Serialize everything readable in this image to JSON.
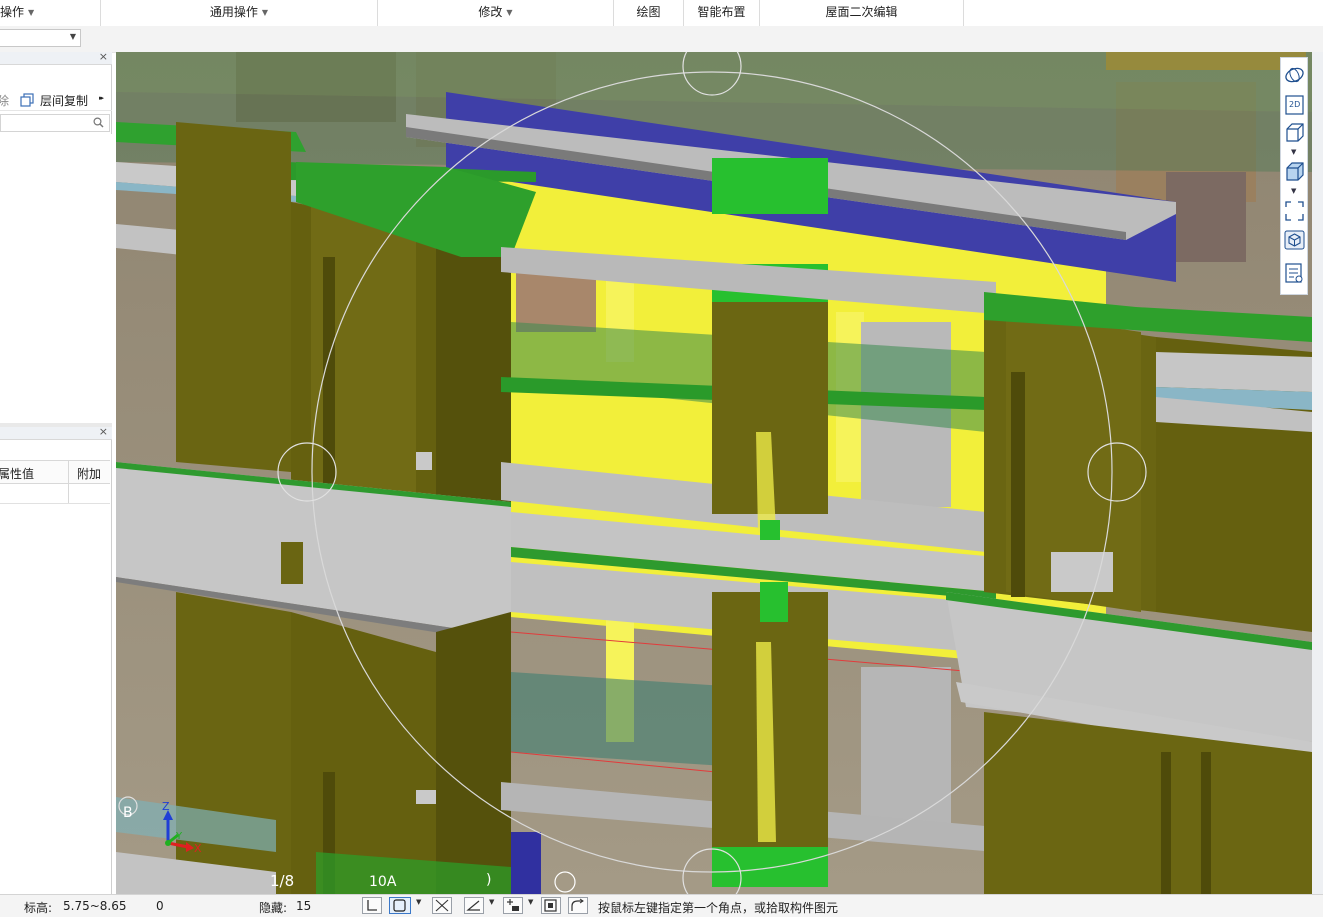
{
  "ribbon": {
    "groups": [
      {
        "label": "操作"
      },
      {
        "label": "通用操作"
      },
      {
        "label": "修改"
      },
      {
        "label": "绘图"
      },
      {
        "label": "智能布置"
      },
      {
        "label": "屋面二次编辑"
      }
    ]
  },
  "left_panel": {
    "tool_partial": "除",
    "tool_copy": "层间复制",
    "more_glyph": "▸▸",
    "close_glyph": "×"
  },
  "properties": {
    "col_value": "属性值",
    "col_extra": "附加"
  },
  "view_toolbar": {
    "icons": [
      "orbit-icon",
      "view-2d-icon",
      "view-3d-box-icon",
      "view-3d-solid-icon",
      "select-region-icon",
      "isolate-icon",
      "properties-list-icon"
    ],
    "label_2d": "2D"
  },
  "viewport": {
    "compass_top_label": "B",
    "bottom_label_left": "1/8",
    "bottom_label_mid": "10A",
    "bottom_label_right": ")",
    "axis_x": "X",
    "axis_y": "Y",
    "axis_z": "Z",
    "colors": {
      "column": "#6b6612",
      "beam_green": "#1f9a2a",
      "slab_gray": "#c3c3c3",
      "wall_yellow": "#f5f23c",
      "beam_blue": "#3f3fa8",
      "background": "#9a8f7e"
    }
  },
  "status": {
    "elevation_label": "标高:",
    "elevation_value": "5.75~8.65",
    "count": "0",
    "hidden_label": "隐藏:",
    "hidden_value": "15",
    "prompt": "按鼠标左键指定第一个角点，或拾取构件图元"
  }
}
